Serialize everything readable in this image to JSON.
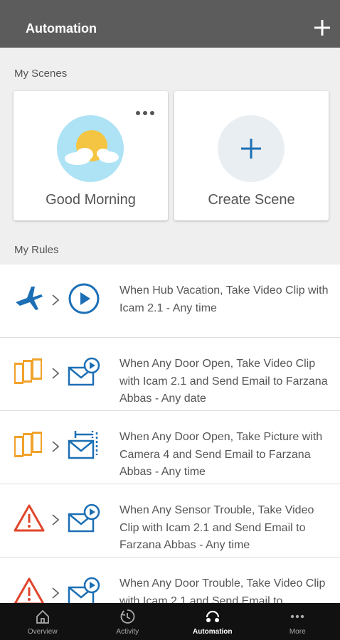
{
  "header": {
    "title": "Automation",
    "add_icon": "plus-icon"
  },
  "scenes": {
    "section_label": "My Scenes",
    "items": [
      {
        "label": "Good Morning",
        "icon": "sun-cloud-icon"
      },
      {
        "label": "Create Scene",
        "icon": "plus-circle-icon"
      }
    ]
  },
  "rules": {
    "section_label": "My Rules",
    "items": [
      {
        "trigger_icon": "airplane-icon",
        "action_icon": "play-circle-icon",
        "text": "When Hub Vacation, Take Video Clip with Icam 2.1 - Any time"
      },
      {
        "trigger_icon": "doors-icon",
        "action_icon": "video-email-icon",
        "text": "When Any Door Open, Take Video Clip with Icam 2.1 and Send Email to Farzana Abbas - Any date"
      },
      {
        "trigger_icon": "doors-icon",
        "action_icon": "picture-email-icon",
        "text": "When Any Door Open, Take Picture with Camera 4 and Send Email to Farzana Abbas - Any time"
      },
      {
        "trigger_icon": "warning-icon",
        "action_icon": "video-email-icon",
        "text": "When Any Sensor Trouble, Take Video Clip with Icam 2.1 and Send Email to Farzana Abbas - Any time"
      },
      {
        "trigger_icon": "warning-icon",
        "action_icon": "video-email-icon",
        "text": "When Any Door Trouble, Take Video Clip with Icam 2.1 and Send Email to"
      }
    ]
  },
  "tabbar": {
    "tabs": [
      {
        "label": "Overview",
        "icon": "home-icon"
      },
      {
        "label": "Activity",
        "icon": "activity-clock-icon"
      },
      {
        "label": "Automation",
        "icon": "automation-icon",
        "active": true
      },
      {
        "label": "More",
        "icon": "more-dots-icon"
      }
    ]
  },
  "colors": {
    "header": "#5c5c5c",
    "accent_blue": "#1c6fb5",
    "accent_orange": "#f0a22a",
    "warning_red": "#e0452b",
    "tabbar": "#111111"
  }
}
